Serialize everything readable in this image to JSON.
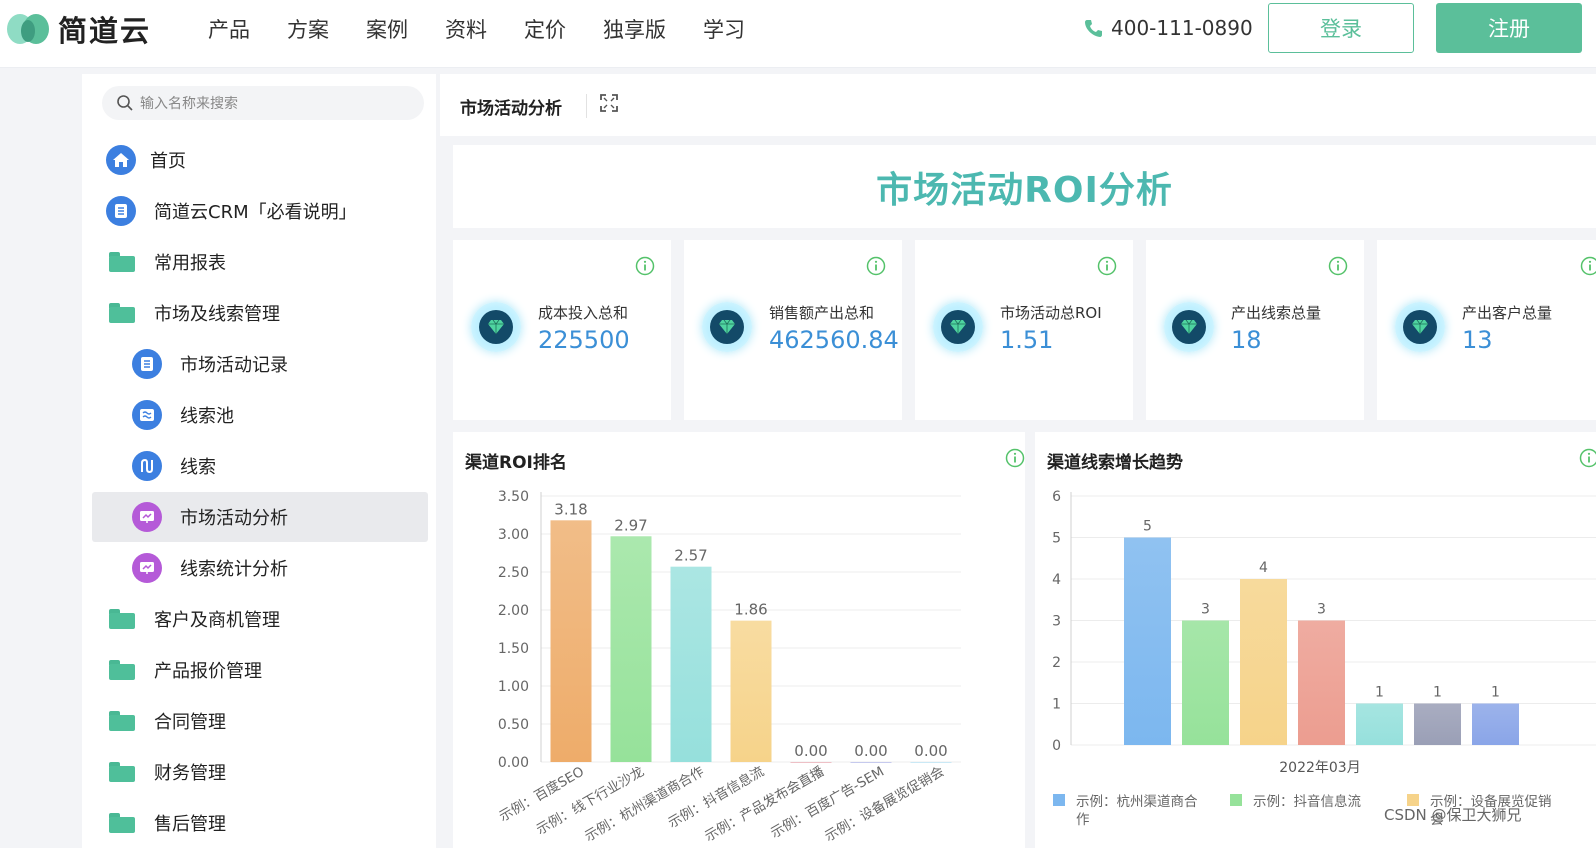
{
  "header": {
    "brand": "简道云",
    "nav": [
      "产品",
      "方案",
      "案例",
      "资料",
      "定价",
      "独享版",
      "学习"
    ],
    "phone": "400-111-0890",
    "login": "登录",
    "register": "注册"
  },
  "sidebar": {
    "search_placeholder": "输入名称来搜索",
    "items": [
      {
        "label": "首页",
        "icon": "home-icon"
      },
      {
        "label": "简道云CRM「必看说明」",
        "icon": "doc-icon"
      },
      {
        "label": "常用报表",
        "icon": "folder-icon"
      },
      {
        "label": "市场及线索管理",
        "icon": "folder-open-icon"
      },
      {
        "label": "市场活动记录",
        "icon": "doc-icon"
      },
      {
        "label": "线索池",
        "icon": "list-icon"
      },
      {
        "label": "线索",
        "icon": "path-icon"
      },
      {
        "label": "市场活动分析",
        "icon": "dashboard-icon"
      },
      {
        "label": "线索统计分析",
        "icon": "dashboard-icon"
      },
      {
        "label": "客户及商机管理",
        "icon": "folder-icon"
      },
      {
        "label": "产品报价管理",
        "icon": "folder-icon"
      },
      {
        "label": "合同管理",
        "icon": "folder-icon"
      },
      {
        "label": "财务管理",
        "icon": "folder-icon"
      },
      {
        "label": "售后管理",
        "icon": "folder-icon"
      }
    ]
  },
  "tab": {
    "title": "市场活动分析"
  },
  "banner": {
    "title": "市场活动ROI分析"
  },
  "kpis": [
    {
      "label": "成本投入总和",
      "value": "225500"
    },
    {
      "label": "销售额产出总和",
      "value": "462560.84"
    },
    {
      "label": "市场活动总ROI",
      "value": "1.51"
    },
    {
      "label": "产出线索总量",
      "value": "18"
    },
    {
      "label": "产出客户总量",
      "value": "13"
    }
  ],
  "chart_data": [
    {
      "type": "bar",
      "title": "渠道ROI排名",
      "categories": [
        "示例：百度SEO",
        "示例：线下行业沙龙",
        "示例：杭州渠道商合作",
        "示例：抖音信息流",
        "示例：产品发布会直播",
        "示例：百度广告-SEM",
        "示例：设备展览促销会"
      ],
      "values": [
        3.18,
        2.97,
        2.57,
        1.86,
        0.0,
        0.0,
        0.0
      ],
      "value_labels": [
        "3.18",
        "2.97",
        "2.57",
        "1.86",
        "0.00",
        "0.00",
        "0.00"
      ],
      "yticks": [
        "0.00",
        "0.50",
        "1.00",
        "1.50",
        "2.00",
        "2.50",
        "3.00",
        "3.50"
      ],
      "ylim": [
        0,
        3.5
      ],
      "colors": [
        "#eeac6a",
        "#96e29a",
        "#96e0dc",
        "#f6d38a",
        "#e8a9b0",
        "#b0b6e8",
        "#b7e1f2"
      ],
      "grid": true
    },
    {
      "type": "bar",
      "title": "渠道线索增长趋势",
      "categories": [
        "2022年03月"
      ],
      "series": [
        {
          "name": "示例：杭州渠道商合作",
          "values": [
            5
          ],
          "color": "#7cb7ef"
        },
        {
          "name": "示例：抖音信息流",
          "values": [
            3
          ],
          "color": "#96e29a"
        },
        {
          "name": "示例：设备展览促销会",
          "values": [
            4
          ],
          "color": "#f6d38a"
        },
        {
          "name": "",
          "values": [
            3
          ],
          "color": "#ec9d90"
        },
        {
          "name": "",
          "values": [
            1
          ],
          "color": "#96e0dc"
        },
        {
          "name": "",
          "values": [
            1
          ],
          "color": "#9a9fb6"
        },
        {
          "name": "",
          "values": [
            1
          ],
          "color": "#8aa5e8"
        }
      ],
      "value_labels": [
        "5",
        "3",
        "4",
        "3",
        "1",
        "1",
        "1"
      ],
      "yticks": [
        "0",
        "1",
        "2",
        "3",
        "4",
        "5",
        "6"
      ],
      "ylim": [
        0,
        6
      ],
      "legend_position": "bottom",
      "grid": true
    }
  ],
  "watermark": "CSDN @保卫大狮兄"
}
